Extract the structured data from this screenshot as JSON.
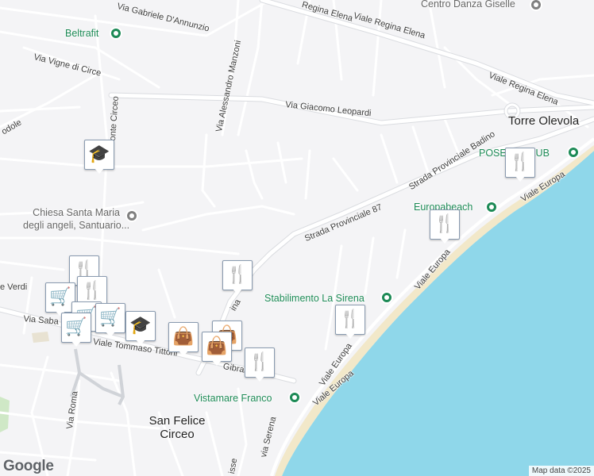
{
  "colors": {
    "land": "#f4f4f6",
    "road": "#ffffff",
    "road_edge": "#dadce0",
    "water": "#8fd7ea",
    "beach": "#f2e8c9",
    "green_area": "#cfe8c6",
    "poi_green": "#1d8a56",
    "marker_icon": "#1a3f66"
  },
  "streets": {
    "regina_elena_1": "Regina Elena",
    "regina_elena_2": "Viale Regina Elena",
    "regina_elena_3": "Viale Regina Elena",
    "dannunzio": "Via Gabriele D'Annunzio",
    "vigne_circe": "Via Vigne di Circe",
    "manzoni": "Via Alessandro Manzoni",
    "monte_circeo": "onte Circeo",
    "leopardi": "Via Giacomo Leopardi",
    "badino": "Strada Provinciale Badino",
    "sp87": "Strada Provinciale 87",
    "europa_1": "Viale Europa",
    "europa_2": "Viale Europa",
    "europa_3": "Viale Europa",
    "europa_4": "Viale Europa",
    "verdi": "e Verdi",
    "sabaudia": "Via Saba",
    "tittoni": "Viale Tommaso Tittoni",
    "gibral": "Gibral",
    "ina": "ina",
    "roma": "Via Roma",
    "serena": "via Serena",
    "isse": "isse",
    "odole": "odole"
  },
  "places": {
    "beltrafit": "Beltrafit",
    "centro_danza": "Centro Danza Giselle",
    "chiesa": "Chiesa Santa Maria\ndegli angeli, Santuario...",
    "poseidon": "POSE      CLUB",
    "europabeach": "Europabeach",
    "la_sirena": "Stabilimento La Sirena",
    "vistamare": "Vistamare Franco"
  },
  "towns": {
    "torre_olevola": "Torre Olevola",
    "san_felice": "San Felice\nCirceo"
  },
  "markers": [
    {
      "icon": "graduation-cap-icon",
      "glyph": "🎓"
    },
    {
      "icon": "restaurant-icon",
      "glyph": "🍴"
    },
    {
      "icon": "restaurant-icon",
      "glyph": "🍴"
    },
    {
      "icon": "restaurant-icon",
      "glyph": "🍴"
    },
    {
      "icon": "restaurant-icon",
      "glyph": "🍴"
    },
    {
      "icon": "restaurant-icon",
      "glyph": "🍴"
    },
    {
      "icon": "restaurant-icon",
      "glyph": "🍴"
    },
    {
      "icon": "restaurant-icon",
      "glyph": "🍴"
    },
    {
      "icon": "shopping-cart-icon",
      "glyph": "🛒"
    },
    {
      "icon": "shopping-cart-icon",
      "glyph": "🛒"
    },
    {
      "icon": "shopping-cart-icon",
      "glyph": "🛒"
    },
    {
      "icon": "shopping-cart-icon",
      "glyph": "🛒"
    },
    {
      "icon": "graduation-cap-icon",
      "glyph": "🎓"
    },
    {
      "icon": "shopping-bag-icon",
      "glyph": "👜"
    },
    {
      "icon": "shopping-bag-icon",
      "glyph": "👜"
    },
    {
      "icon": "shopping-bag-icon",
      "glyph": "👜"
    }
  ],
  "footer": {
    "logo": "Google",
    "attribution": "Map data ©2025"
  }
}
